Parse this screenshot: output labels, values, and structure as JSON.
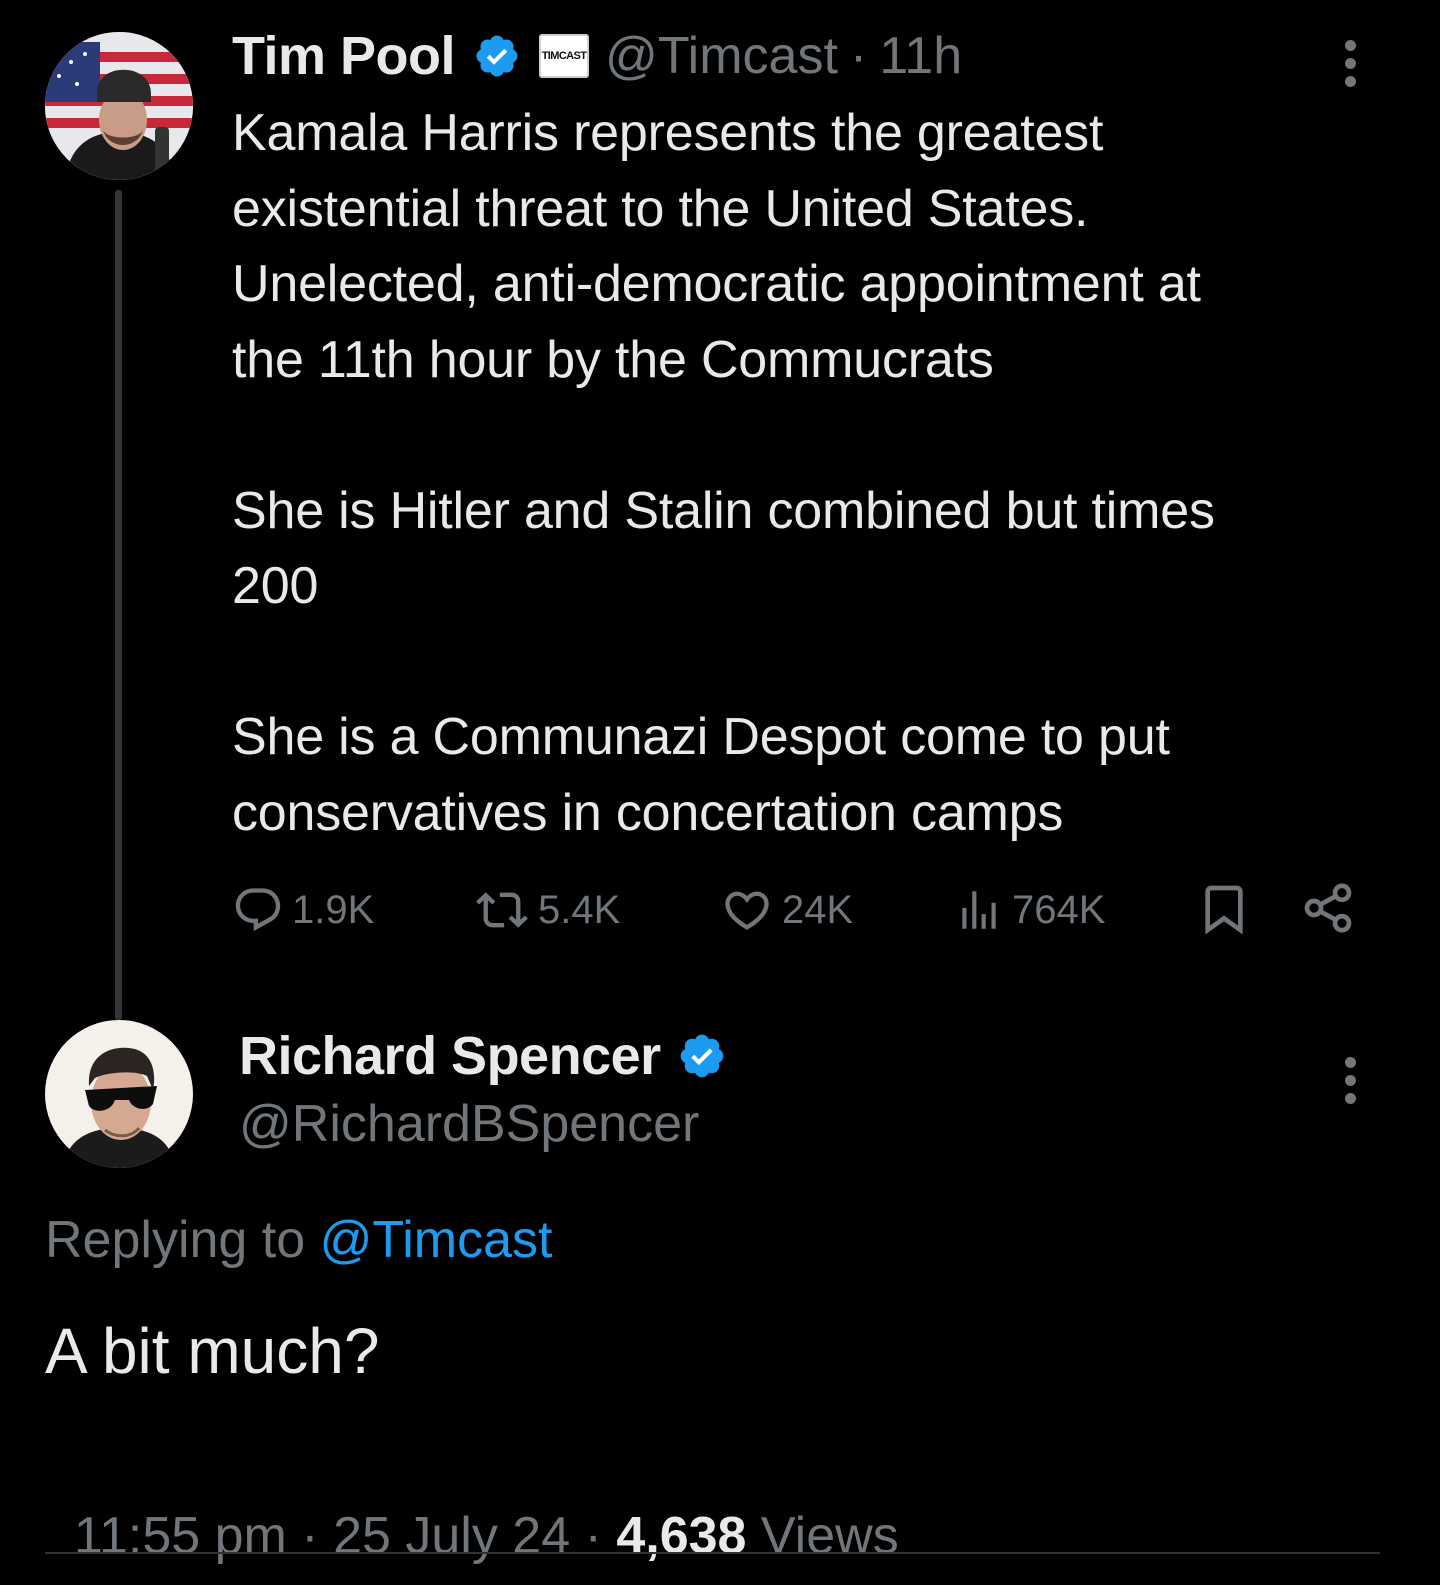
{
  "main_tweet": {
    "author_name": "Tim Pool",
    "affiliate_badge": "TIMCAST",
    "handle": "@Timcast",
    "separator": "·",
    "time_ago": "11h",
    "text": "Kamala Harris represents the greatest\nexistential threat to the United States.\nUnelected, anti-democratic appointment at\nthe 11th hour by the Commucrats\n\nShe is Hitler and Stalin combined but times\n200\n\nShe is a Communazi Despot come to put\nconservatives in concertation camps",
    "actions": {
      "replies": "1.9K",
      "reposts": "5.4K",
      "likes": "24K",
      "views": "764K"
    },
    "icons": [
      "verified-badge-icon",
      "reply-icon",
      "repost-icon",
      "like-icon",
      "views-icon",
      "bookmark-icon",
      "share-icon",
      "more-icon"
    ]
  },
  "reply_tweet": {
    "author_name": "Richard Spencer",
    "handle": "@RichardBSpencer",
    "replying_prefix": "Replying to ",
    "replying_handle": "@Timcast",
    "text": "A bit much?",
    "time": "11:55 pm",
    "sep1": " · ",
    "date": "25 July 24",
    "sep2": " · ",
    "views_count": "4,638",
    "views_label": " Views"
  },
  "colors": {
    "background": "#000000",
    "text": "#e7e9ea",
    "muted": "#71767b",
    "accent": "#1d9bf0",
    "thread_line": "#333639"
  }
}
